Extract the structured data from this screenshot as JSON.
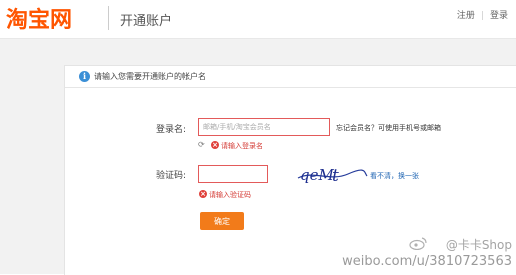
{
  "header": {
    "logo": "淘宝网",
    "subtitle": "开通账户",
    "nav": {
      "register": "注册",
      "login": "登录"
    }
  },
  "notice": {
    "text": "请输入您需要开通账户的帐户名"
  },
  "form": {
    "username": {
      "label": "登录名:",
      "placeholder": "邮箱/手机/淘宝会员名",
      "hint": "忘记会员名？可使用手机号或邮箱",
      "error": "请输入登录名"
    },
    "captcha": {
      "label": "验证码:",
      "image_text": "qeM",
      "refresh_link": "看不清，换一张",
      "error": "请输入验证码"
    },
    "submit": "确定"
  },
  "watermark": {
    "brand": "@卡卡Shop",
    "url": "weibo.com/u/3810723563"
  },
  "colors": {
    "brand": "#ff5500",
    "error": "#d43b35",
    "button": "#f27b1a",
    "link": "#1f65b3"
  }
}
